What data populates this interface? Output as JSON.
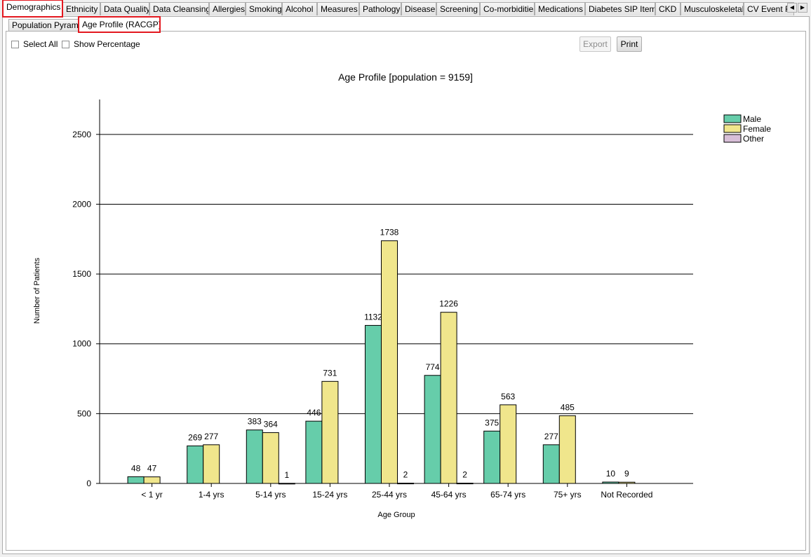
{
  "tabs": [
    {
      "label": "Demographics",
      "active": true,
      "highlight": true
    },
    {
      "label": "Ethnicity"
    },
    {
      "label": "Data Quality"
    },
    {
      "label": "Data Cleansing"
    },
    {
      "label": "Allergies"
    },
    {
      "label": "Smoking"
    },
    {
      "label": "Alcohol"
    },
    {
      "label": "Measures"
    },
    {
      "label": "Pathology"
    },
    {
      "label": "Disease"
    },
    {
      "label": "Screening"
    },
    {
      "label": "Co-morbidities"
    },
    {
      "label": "Medications"
    },
    {
      "label": "Diabetes SIP Items"
    },
    {
      "label": "CKD"
    },
    {
      "label": "Musculoskeletal"
    },
    {
      "label": "CV Event Risk"
    }
  ],
  "subtabs": [
    {
      "label": "Population Pyramid"
    },
    {
      "label": "Age Profile (RACGP)",
      "active": true,
      "highlight": true
    }
  ],
  "controls": {
    "select_all_label": "Select All",
    "show_percentage_label": "Show Percentage",
    "export_label": "Export",
    "print_label": "Print"
  },
  "chart_data": {
    "type": "bar",
    "title": "Age Profile [population = 9159]",
    "xlabel": "Age Group",
    "ylabel": "Number of Patients",
    "ylim": [
      0,
      2750
    ],
    "yticks": [
      0,
      500,
      1000,
      1500,
      2000,
      2500
    ],
    "grid": true,
    "legend_position": "top-right",
    "categories": [
      "< 1 yr",
      "1-4 yrs",
      "5-14 yrs",
      "15-24 yrs",
      "25-44 yrs",
      "45-64 yrs",
      "65-74 yrs",
      "75+ yrs",
      "Not Recorded"
    ],
    "series": [
      {
        "name": "Male",
        "color": "#66cdaa",
        "values": [
          48,
          269,
          383,
          446,
          1132,
          774,
          375,
          277,
          10
        ]
      },
      {
        "name": "Female",
        "color": "#f0e68c",
        "values": [
          47,
          277,
          364,
          731,
          1738,
          1226,
          563,
          485,
          9
        ]
      },
      {
        "name": "Other",
        "color": "#d8bfd8",
        "values": [
          0,
          0,
          1,
          0,
          2,
          2,
          0,
          0,
          0
        ]
      }
    ]
  }
}
